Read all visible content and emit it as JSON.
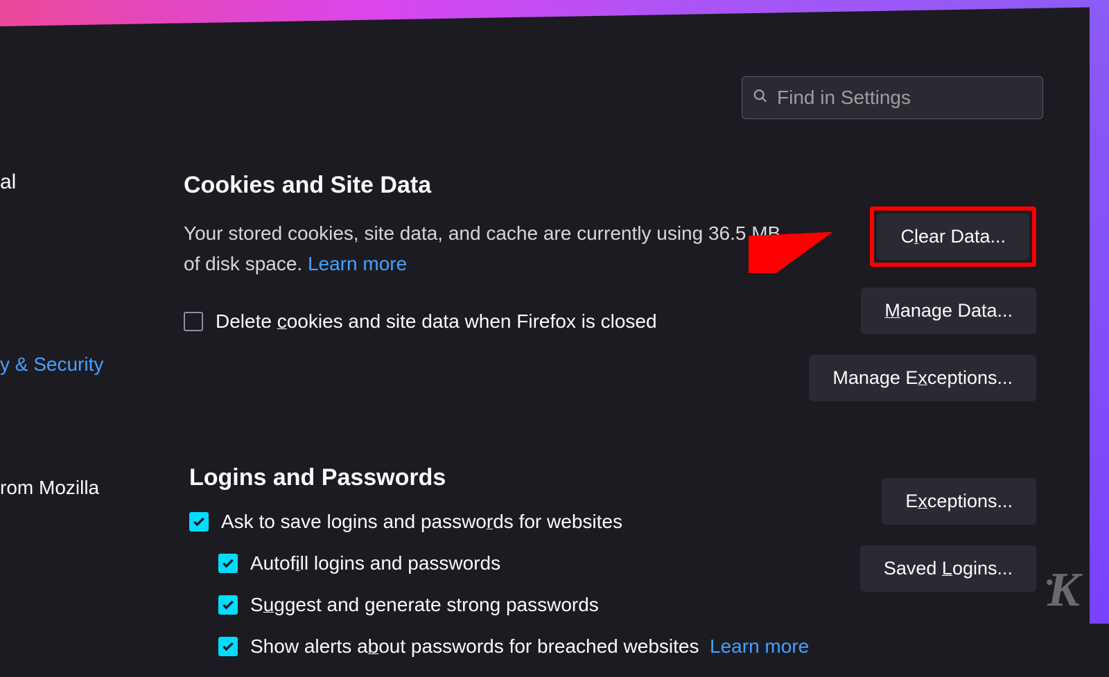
{
  "search": {
    "placeholder": "Find in Settings"
  },
  "sidebar": {
    "partial_general": "al",
    "active": "y & Security",
    "partial_more": "rom Mozilla"
  },
  "cookies": {
    "title": "Cookies and Site Data",
    "desc_pre": "Your stored cookies, site data, and cache are currently using 36.5 MB of disk space.   ",
    "learn_more": "Learn more",
    "delete_label_pre": "Delete ",
    "delete_label_u": "c",
    "delete_label_post": "ookies and site data when Firefox is closed",
    "clear_btn_pre": "C",
    "clear_btn_u": "l",
    "clear_btn_post": "ear Data...",
    "manage_btn_u": "M",
    "manage_btn_post": "anage Data...",
    "exceptions_btn_pre": "Manage E",
    "exceptions_btn_u": "x",
    "exceptions_btn_post": "ceptions..."
  },
  "logins": {
    "title": "Logins and Passwords",
    "ask_label_pre": "Ask to save logins and passwo",
    "ask_label_u": "r",
    "ask_label_post": "ds for websites",
    "autofill_pre": "Autof",
    "autofill_u": "i",
    "autofill_post": "ll logins and passwords",
    "suggest_pre": "S",
    "suggest_u": "u",
    "suggest_post": "ggest and generate strong passwords",
    "alerts_pre": "Show alerts a",
    "alerts_u": "b",
    "alerts_post": "out passwords for breached websites",
    "learn_more": "Learn more",
    "exceptions_btn_pre": "E",
    "exceptions_btn_u": "x",
    "exceptions_btn_post": "ceptions...",
    "saved_btn_pre": "Saved ",
    "saved_btn_u": "L",
    "saved_btn_post": "ogins..."
  },
  "watermark": "K"
}
